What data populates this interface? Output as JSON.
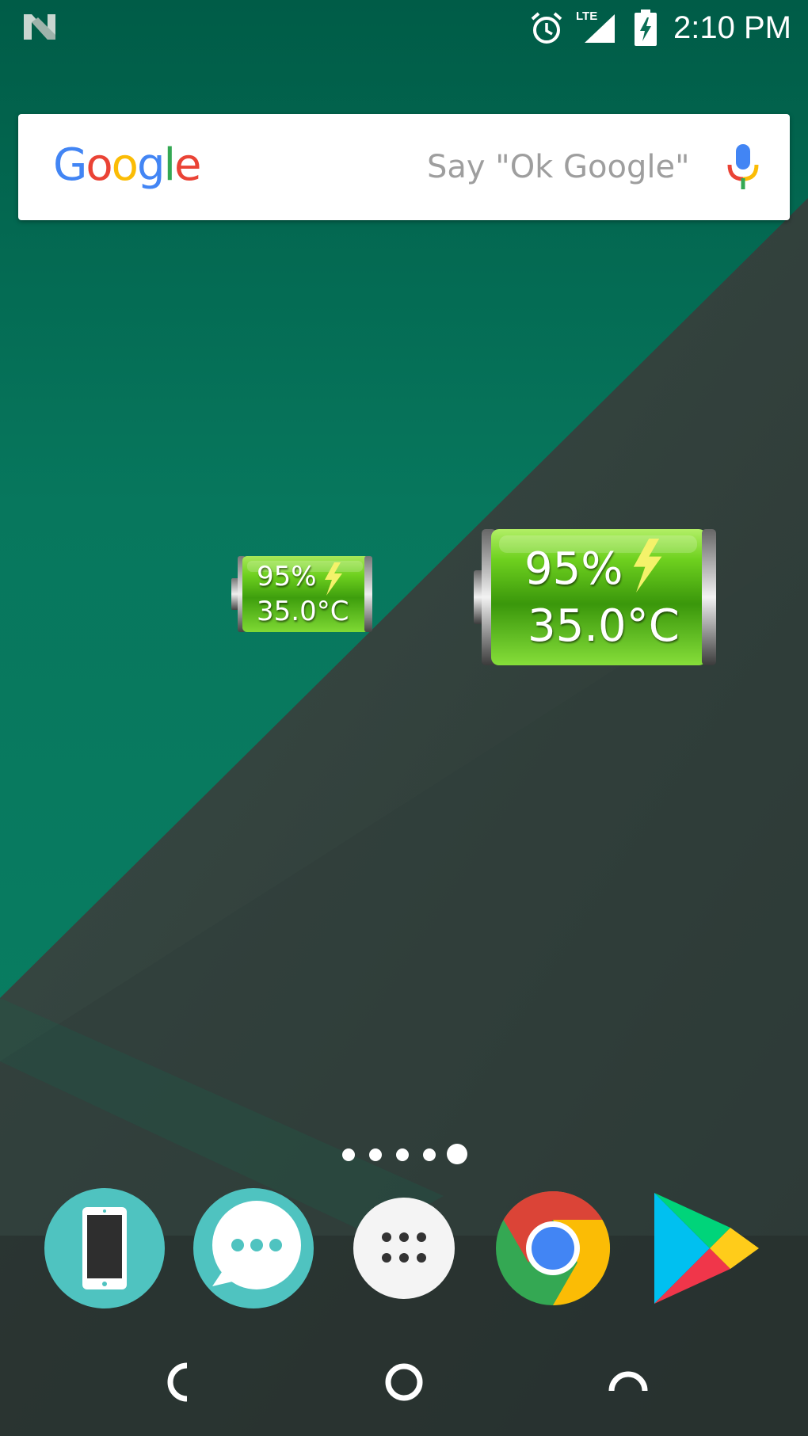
{
  "status_bar": {
    "time": "2:10 PM",
    "network": "LTE",
    "icons": [
      "notification-n-icon",
      "alarm-icon",
      "lte-signal-icon",
      "battery-charging-icon"
    ]
  },
  "search_widget": {
    "logo_text": "Google",
    "hint": "Say \"Ok Google\"",
    "mic_icon": "mic-icon"
  },
  "battery_widgets": [
    {
      "size": "small",
      "percent": "95%",
      "temperature": "35.0°C",
      "charging_icon": "bolt-icon"
    },
    {
      "size": "large",
      "percent": "95%",
      "temperature": "35.0°C",
      "charging_icon": "bolt-icon"
    }
  ],
  "home_page": {
    "page_count": 5,
    "current_page": 5
  },
  "dock": [
    {
      "app": "phone-icon"
    },
    {
      "app": "messages-icon"
    },
    {
      "app": "app-drawer-icon"
    },
    {
      "app": "chrome-icon"
    },
    {
      "app": "play-store-icon"
    }
  ],
  "nav_bar": [
    "back-icon",
    "home-icon",
    "recents-icon"
  ],
  "colors": {
    "wallpaper_teal": "#0b7258",
    "wallpaper_dark": "#2d3b36",
    "battery_green": "#5cc21a",
    "google_blue": "#4285F4",
    "google_red": "#EA4335",
    "google_yellow": "#FBBC05",
    "google_green": "#34A853",
    "dock_teal": "#4fc3c0"
  }
}
